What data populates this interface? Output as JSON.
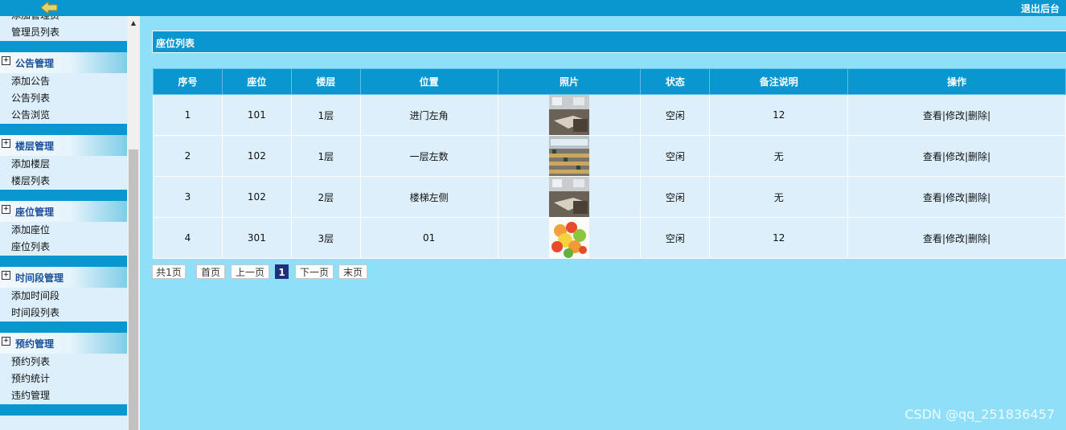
{
  "header": {
    "logout_label": "退出后台"
  },
  "sidebar": {
    "top_items": [
      "添加管理员",
      "管理员列表"
    ],
    "groups": [
      {
        "title": "公告管理",
        "items": [
          "添加公告",
          "公告列表",
          "公告浏览"
        ]
      },
      {
        "title": "楼层管理",
        "items": [
          "添加楼层",
          "楼层列表"
        ]
      },
      {
        "title": "座位管理",
        "items": [
          "添加座位",
          "座位列表"
        ]
      },
      {
        "title": "时间段管理",
        "items": [
          "添加时间段",
          "时间段列表"
        ]
      },
      {
        "title": "预约管理",
        "items": [
          "预约列表",
          "预约统计",
          "违约管理"
        ]
      }
    ]
  },
  "panel": {
    "title": "座位列表"
  },
  "table": {
    "headers": [
      "序号",
      "座位",
      "楼层",
      "位置",
      "照片",
      "状态",
      "备注说明",
      "操作"
    ],
    "rows": [
      {
        "no": "1",
        "seat": "101",
        "floor": "1层",
        "location": "进门左角",
        "photo": "classroom-photo",
        "status": "空闲",
        "note": "12"
      },
      {
        "no": "2",
        "seat": "102",
        "floor": "1层",
        "location": "一层左数",
        "photo": "reading-room-photo",
        "status": "空闲",
        "note": "无"
      },
      {
        "no": "3",
        "seat": "102",
        "floor": "2层",
        "location": "楼梯左侧",
        "photo": "classroom-photo",
        "status": "空闲",
        "note": "无"
      },
      {
        "no": "4",
        "seat": "301",
        "floor": "3层",
        "location": "01",
        "photo": "candy-photo",
        "status": "空闲",
        "note": "12"
      }
    ],
    "ops": {
      "view": "查看",
      "sep": "|",
      "edit": "修改",
      "delete": "删除"
    }
  },
  "pagination": {
    "total": "共1页",
    "first": "首页",
    "prev": "上一页",
    "current": "1",
    "next": "下一页",
    "last": "末页"
  },
  "watermark": "CSDN @qq_251836457",
  "colors": {
    "header_bg": "#0a96cf",
    "content_bg": "#8fdff9",
    "row_bg": "#dceffa",
    "menu_title": "#1b4f9a"
  }
}
